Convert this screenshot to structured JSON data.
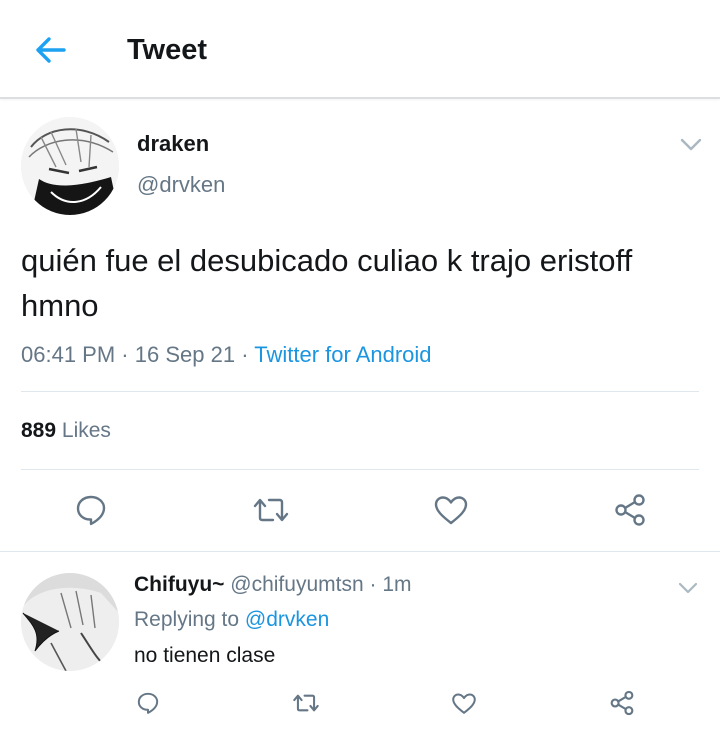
{
  "header": {
    "back_icon": "arrow-left-icon",
    "title": "Tweet",
    "accent_color": "#1da1f2"
  },
  "tweet": {
    "author_name": "draken",
    "author_handle": "@drvken",
    "text": "quién fue el desubicado culiao k trajo eristoff hmno",
    "time": "06:41 PM",
    "date": "16 Sep 21",
    "separator": "·",
    "source": "Twitter for Android",
    "likes_count": "889",
    "likes_label": "Likes",
    "actions": [
      "reply-icon",
      "retweet-icon",
      "like-icon",
      "share-icon"
    ]
  },
  "reply": {
    "author_name": "Chifuyu~",
    "author_handle": "@chifuyumtsn",
    "separator": "·",
    "time": "1m",
    "replying_label": "Replying to",
    "replying_to": "@drvken",
    "text": "no tienen clase",
    "actions": [
      "reply-icon",
      "retweet-icon",
      "like-icon",
      "share-icon"
    ]
  },
  "colors": {
    "text_primary": "#14171a",
    "text_secondary": "#657786",
    "link": "#1b95e0",
    "icon": "#657786",
    "divider": "#e1e8ed"
  }
}
